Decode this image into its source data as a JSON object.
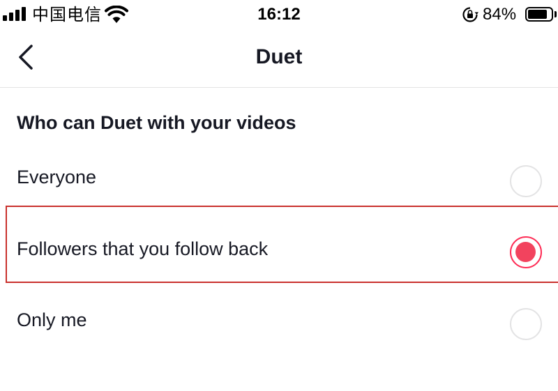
{
  "status_bar": {
    "carrier": "中国电信",
    "time": "16:12",
    "battery_percent": "84%",
    "battery_level": 0.84,
    "icons": [
      "signal-icon",
      "wifi-icon",
      "rotation-lock-icon",
      "battery-icon"
    ]
  },
  "nav": {
    "title": "Duet",
    "back_icon": "chevron-left-icon"
  },
  "section": {
    "heading": "Who can Duet with your videos"
  },
  "options": [
    {
      "label": "Everyone",
      "selected": false
    },
    {
      "label": "Followers that you follow back",
      "selected": true
    },
    {
      "label": "Only me",
      "selected": false
    }
  ],
  "colors": {
    "accent": "#fe2c55",
    "highlight_border": "#c9302c",
    "text": "#161823",
    "divider": "#e3e3e4"
  }
}
